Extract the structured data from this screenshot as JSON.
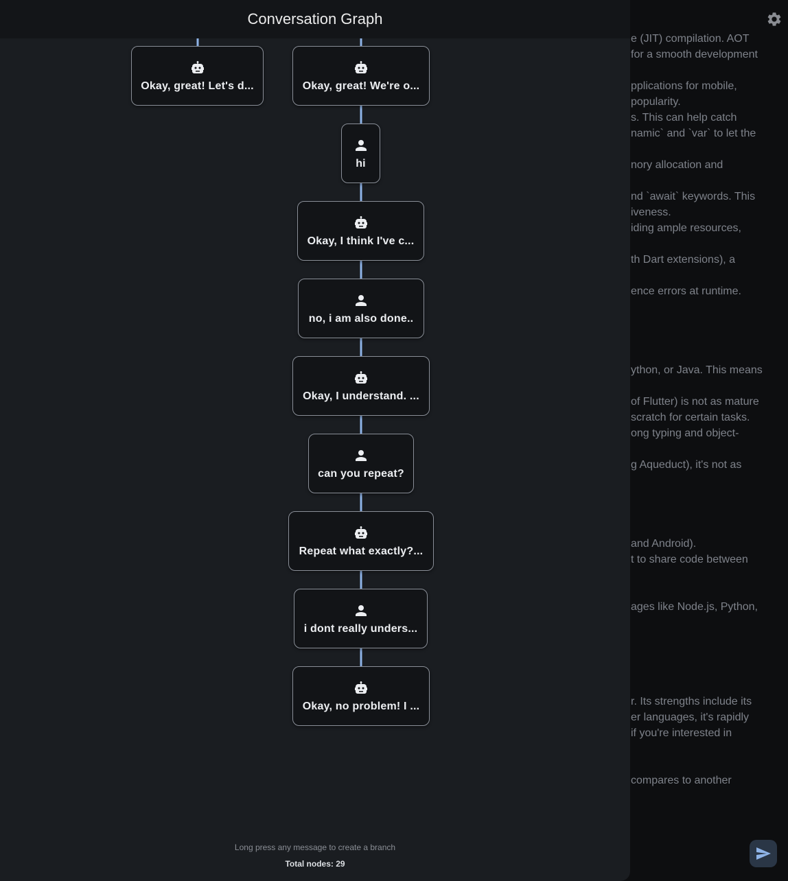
{
  "sheet": {
    "title": "Conversation Graph",
    "hint": "Long press any message to create a branch",
    "total_nodes": "Total nodes: 29"
  },
  "nodes": [
    {
      "role": "assistant",
      "icon": "robot-icon",
      "label": "Okay, great! Let's d..."
    },
    {
      "role": "assistant",
      "icon": "robot-icon",
      "label": "Okay, great! We're o..."
    },
    {
      "role": "user",
      "icon": "person-icon",
      "label": "hi"
    },
    {
      "role": "assistant",
      "icon": "robot-icon",
      "label": "Okay, I think I've c..."
    },
    {
      "role": "user",
      "icon": "person-icon",
      "label": "no, i am also done.."
    },
    {
      "role": "assistant",
      "icon": "robot-icon",
      "label": "Okay, I understand. ..."
    },
    {
      "role": "user",
      "icon": "person-icon",
      "label": "can you repeat?"
    },
    {
      "role": "assistant",
      "icon": "robot-icon",
      "label": "Repeat what exactly?..."
    },
    {
      "role": "user",
      "icon": "person-icon",
      "label": "i dont really unders..."
    },
    {
      "role": "assistant",
      "icon": "robot-icon",
      "label": "Okay, no problem! I ..."
    }
  ],
  "background_chat": {
    "lines": [
      "e (JIT) compilation. AOT",
      " for a smooth development",
      "pplications for mobile,",
      "popularity.",
      "s. This can help catch",
      "namic` and `var` to let the",
      "nory allocation and",
      "nd `await` keywords. This",
      "iveness.",
      "iding ample resources,",
      "th Dart extensions), a",
      "ence errors at runtime.",
      "ython, or Java. This means",
      "of Flutter) is not as mature",
      "scratch for certain tasks.",
      "ong typing and object-",
      "g Aqueduct), it's not as",
      "and Android).",
      "t to share code between",
      "ages like Node.js, Python,",
      "r. Its strengths include its",
      "er languages, it's rapidly",
      "if you're interested in",
      " compares to another"
    ]
  },
  "colors": {
    "edge": "#8fb4e8",
    "node_border": "#8a8f98",
    "sheet_bg": "#1a1d21"
  }
}
